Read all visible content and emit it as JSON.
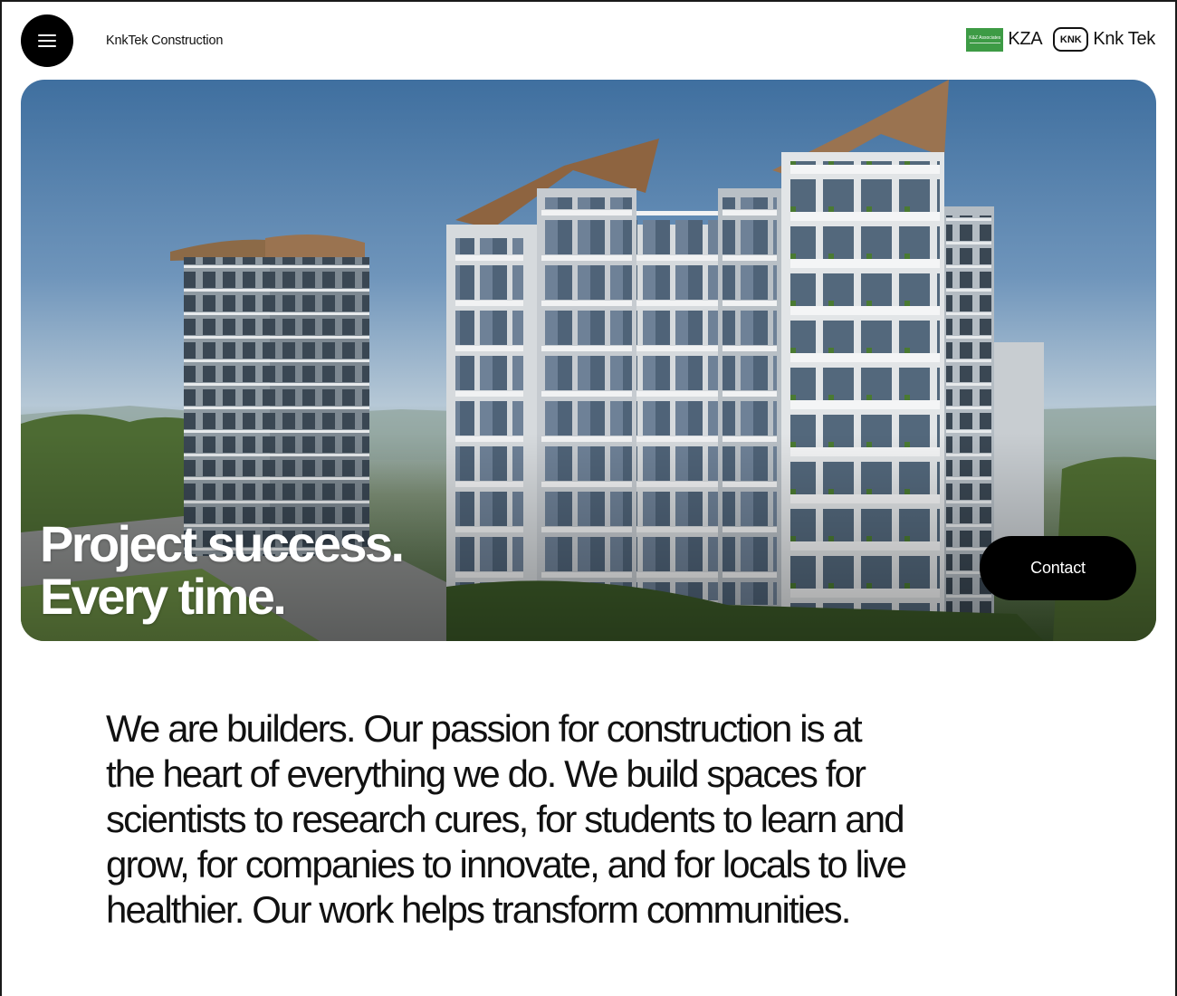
{
  "header": {
    "menu_icon": "hamburger-icon",
    "brand": "KnkTek Construction",
    "partners": [
      {
        "name": "KZA",
        "logo_text": "K&Z Associates",
        "logo_color": "#3d9b45"
      },
      {
        "name": "Knk Tek",
        "logo_text": "KNK"
      }
    ]
  },
  "hero": {
    "headline_line1": "Project success.",
    "headline_line2": "Every time.",
    "contact_label": "Contact"
  },
  "intro": {
    "lines": [
      "We are builders. Our passion for construction is at",
      "the heart of everything we do. We build spaces for",
      "scientists to research cures, for students to learn and",
      "grow, for companies to innovate, and for locals to live",
      "healthier. Our work helps transform communities."
    ]
  },
  "colors": {
    "accent": "#000000",
    "text": "#111111",
    "partner_green": "#3d9b45"
  }
}
